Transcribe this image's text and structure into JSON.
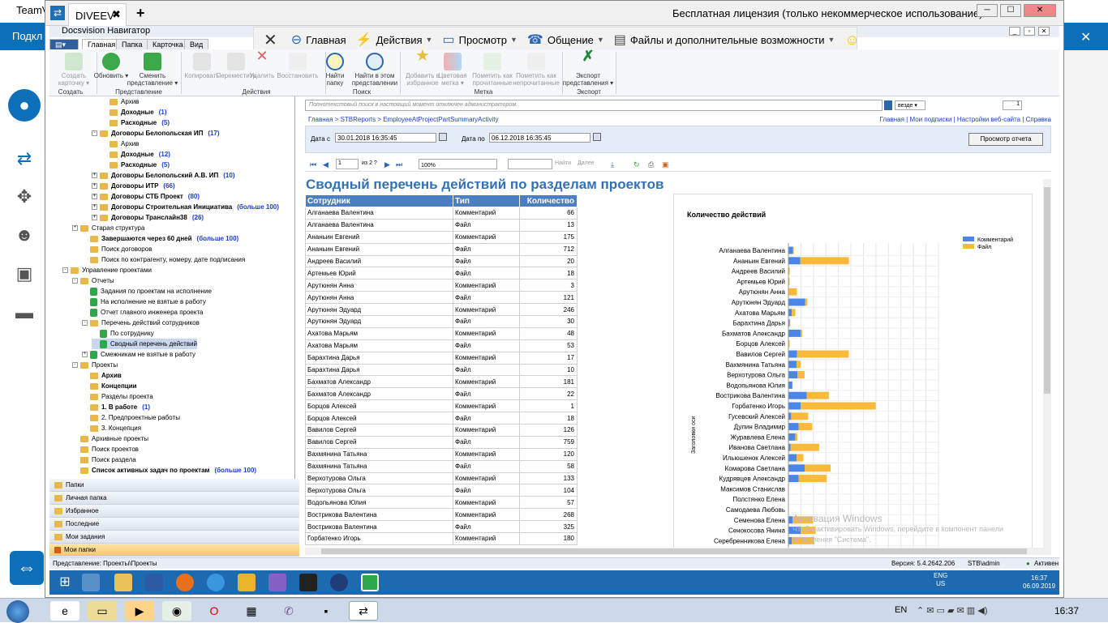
{
  "bg": {
    "tv_title": "TeamV",
    "tv_band_label": "Подкл"
  },
  "window": {
    "tab_label": "DIVEEV",
    "tab_close": "✖",
    "tab_new": "+",
    "license": "Бесплатная лицензия (только некоммерческое использование)",
    "btn_min": "─",
    "btn_max": "☐",
    "btn_close": "✕"
  },
  "app": {
    "title": "Docsvision Навигатор",
    "inner_min": "_",
    "inner_max": "▫",
    "inner_close": "✕"
  },
  "tvtoolbar": {
    "close": "✕",
    "items": [
      "Главная",
      "Действия",
      "Просмотр",
      "Общение",
      "Файлы и дополнительные возможности"
    ]
  },
  "ribbon": {
    "tabs": [
      "Главная",
      "Папка",
      "Карточка",
      "Вид"
    ],
    "buttons": {
      "create": "Создать карточку ▾",
      "refresh": "Обновить ▾",
      "change_view": "Сменить представление ▾",
      "copy": "Копировать",
      "move": "Переместить",
      "delete": "Удалить",
      "restore": "Восстановить",
      "find_folder": "Найти папку",
      "find_in_view": "Найти в этом представлении",
      "add_fav": "Добавить в избранное",
      "color_mark": "Цветовая метка ▾",
      "mark_read": "Пометить как прочитанные",
      "mark_unread": "Пометить как непрочитанные",
      "export_view": "Экспорт представления ▾"
    },
    "groups": {
      "create": "Создать",
      "view": "Представление",
      "actions": "Действия",
      "search": "Поиск",
      "mark": "Метка",
      "export": "Экспорт"
    }
  },
  "tree": [
    {
      "label": "Архив",
      "indent": 5,
      "type": "folder"
    },
    {
      "label": "Доходные",
      "count": "(1)",
      "indent": 5,
      "type": "folder",
      "bold": true
    },
    {
      "label": "Расходные",
      "count": "(5)",
      "indent": 5,
      "type": "folder",
      "bold": true
    },
    {
      "label": "Договоры Белопольская ИП",
      "count": "(17)",
      "indent": 4,
      "type": "folder",
      "bold": true,
      "toggle": "-"
    },
    {
      "label": "Архив",
      "indent": 5,
      "type": "folder"
    },
    {
      "label": "Доходные",
      "count": "(12)",
      "indent": 5,
      "type": "folder",
      "bold": true
    },
    {
      "label": "Расходные",
      "count": "(5)",
      "indent": 5,
      "type": "folder",
      "bold": true
    },
    {
      "label": "Договоры Белопольский А.В. ИП",
      "count": "(10)",
      "indent": 4,
      "type": "folder",
      "bold": true,
      "toggle": "+"
    },
    {
      "label": "Договоры ИТР",
      "count": "(66)",
      "indent": 4,
      "type": "folder",
      "bold": true,
      "toggle": "+"
    },
    {
      "label": "Договоры СТБ Проект",
      "count": "(80)",
      "indent": 4,
      "type": "folder",
      "bold": true,
      "toggle": "+"
    },
    {
      "label": "Договоры Строительная Инициатива",
      "count": "(больше 100)",
      "indent": 4,
      "type": "folder",
      "bold": true,
      "toggle": "+"
    },
    {
      "label": "Договоры Транслайн38",
      "count": "(26)",
      "indent": 4,
      "type": "folder",
      "bold": true,
      "toggle": "+"
    },
    {
      "label": "Старая структура",
      "indent": 2,
      "type": "folder",
      "toggle": "+"
    },
    {
      "label": "Завершаются через 60 дней",
      "count": "(больше 100)",
      "indent": 3,
      "type": "folder",
      "bold": true
    },
    {
      "label": "Поиск договоров",
      "indent": 3,
      "type": "folder"
    },
    {
      "label": "Поиск по контрагенту, номеру, дате подписания",
      "indent": 3,
      "type": "folder"
    },
    {
      "label": "Управление проектами",
      "indent": 1,
      "type": "folder",
      "toggle": "-"
    },
    {
      "label": "Отчеты",
      "indent": 2,
      "type": "folder",
      "toggle": "-"
    },
    {
      "label": "Задания по проектам на исполнение",
      "indent": 3,
      "type": "report"
    },
    {
      "label": "На исполнение не взятые в работу",
      "indent": 3,
      "type": "report"
    },
    {
      "label": "Отчет главного инженера проекта",
      "indent": 3,
      "type": "report"
    },
    {
      "label": "Перечень действий сотрудников",
      "indent": 3,
      "type": "folder",
      "toggle": "-"
    },
    {
      "label": "По сотруднику",
      "indent": 4,
      "type": "report"
    },
    {
      "label": "Сводный перечень действий",
      "indent": 4,
      "type": "report",
      "selected": true
    },
    {
      "label": "Смежникам не взятые в работу",
      "indent": 3,
      "type": "report",
      "toggle": "+"
    },
    {
      "label": "Проекты",
      "indent": 2,
      "type": "folder",
      "toggle": "-"
    },
    {
      "label": "Архив",
      "indent": 3,
      "type": "folder",
      "bold": true
    },
    {
      "label": "Концепции",
      "indent": 3,
      "type": "folder",
      "bold": true
    },
    {
      "label": "Разделы проекта",
      "indent": 3,
      "type": "folder"
    },
    {
      "label": "1. В работе",
      "count": "(1)",
      "indent": 3,
      "type": "folder",
      "bold": true
    },
    {
      "label": "2. Предпроектные работы",
      "indent": 3,
      "type": "folder"
    },
    {
      "label": "3. Концепция",
      "indent": 3,
      "type": "folder"
    },
    {
      "label": "Архивные проекты",
      "indent": 2,
      "type": "folder"
    },
    {
      "label": "Поиск проектов",
      "indent": 2,
      "type": "folder"
    },
    {
      "label": "Поиск раздела",
      "indent": 2,
      "type": "folder"
    },
    {
      "label": "Список активных задач по проектам",
      "count": "(больше 100)",
      "indent": 2,
      "type": "folder",
      "bold": true
    }
  ],
  "nav": [
    "Папки",
    "Личная папка",
    "Избранное",
    "Последние",
    "Мои задания",
    "Мои папки"
  ],
  "content": {
    "search_placeholder": "Полнотекстовый поиск в настоящий момент отключен администратором.",
    "search_scope": "везде",
    "page_box": "1",
    "breadcrumb": "Главная > STBReports > EmployeeAtProjectPartSummaryActivity",
    "top_links": "Главная | Мои подписки | Настройки веб-сайта | Справка",
    "date_from_label": "Дата с",
    "date_from": "30.01.2018 16:35:45",
    "date_to_label": "Дата по",
    "date_to": "06.12.2018 16:35:45",
    "view_report": "Просмотр отчета",
    "toolbar": {
      "page": "1",
      "of": "из 2 ?",
      "zoom": "100%",
      "find": "Найти",
      "next": "Далее"
    },
    "report_title": "Сводный перечень действий по разделам проектов",
    "columns": [
      "Сотрудник",
      "Тип",
      "Количество"
    ],
    "rows": [
      [
        "Алганаева Валентина",
        "Комментарий",
        "66"
      ],
      [
        "Алганаева Валентина",
        "Файл",
        "13"
      ],
      [
        "Ананьин Евгений",
        "Комментарий",
        "175"
      ],
      [
        "Ананьин Евгений",
        "Файл",
        "712"
      ],
      [
        "Андреев Василий",
        "Файл",
        "20"
      ],
      [
        "Артемьев Юрий",
        "Файл",
        "18"
      ],
      [
        "Арутюнян Анна",
        "Комментарий",
        "3"
      ],
      [
        "Арутюнян Анна",
        "Файл",
        "121"
      ],
      [
        "Арутюнян Эдуард",
        "Комментарий",
        "246"
      ],
      [
        "Арутюнян Эдуард",
        "Файл",
        "30"
      ],
      [
        "Ахатова Марьям",
        "Комментарий",
        "48"
      ],
      [
        "Ахатова Марьям",
        "Файл",
        "53"
      ],
      [
        "Барахтина Дарья",
        "Комментарий",
        "17"
      ],
      [
        "Барахтина Дарья",
        "Файл",
        "10"
      ],
      [
        "Бахматов Александр",
        "Комментарий",
        "181"
      ],
      [
        "Бахматов Александр",
        "Файл",
        "22"
      ],
      [
        "Борцов Алексей",
        "Комментарий",
        "1"
      ],
      [
        "Борцов Алексей",
        "Файл",
        "18"
      ],
      [
        "Вавилов Сергей",
        "Комментарий",
        "126"
      ],
      [
        "Вавилов Сергей",
        "Файл",
        "759"
      ],
      [
        "Вахмянина Татьяна",
        "Комментарий",
        "120"
      ],
      [
        "Вахмянина Татьяна",
        "Файл",
        "58"
      ],
      [
        "Верхотурова Ольга",
        "Комментарий",
        "133"
      ],
      [
        "Верхотурова Ольга",
        "Файл",
        "104"
      ],
      [
        "Водопьянова Юлия",
        "Комментарий",
        "57"
      ],
      [
        "Вострикова Валентина",
        "Комментарий",
        "268"
      ],
      [
        "Вострикова Валентина",
        "Файл",
        "325"
      ],
      [
        "Горбатенко Игорь",
        "Комментарий",
        "180"
      ]
    ],
    "watermark1": "Активация Windows",
    "watermark2": "Чтобы активировать Windows, перейдите в компонент панели",
    "watermark3": "управления \"Система\"."
  },
  "chart_data": {
    "type": "bar",
    "orientation": "horizontal",
    "stacked": true,
    "title": "Количество действий",
    "ylabel": "Заголовки оси",
    "legend_position": "top-right",
    "categories": [
      "Алганаева Валентина",
      "Ананьин Евгений",
      "Андреев Василий",
      "Артемьев Юрий",
      "Арутюнян Анна",
      "Арутюнян Эдуард",
      "Ахатова Марьям",
      "Барахтина Дарья",
      "Бахматов Александр",
      "Борцов Алексей",
      "Вавилов Сергей",
      "Вахмянина Татьяна",
      "Верхотурова Ольга",
      "Водопьянова Юлия",
      "Вострикова Валентина",
      "Горбатенко Игорь",
      "Гусевский Алексей",
      "Дулин Владимир",
      "Журавлева Елена",
      "Иванова Светлана",
      "Ильюшенок Алексей",
      "Комарова Светлана",
      "Кудрявцев Александр",
      "Максимов Станислав",
      "Полстянко Елена",
      "Самодаева Любовь",
      "Семенова Елена",
      "Сенокосова Янина",
      "Серебренникова Елена"
    ],
    "series": [
      {
        "name": "Комментарий",
        "color": "#4a86e8",
        "values": [
          66,
          175,
          0,
          0,
          3,
          246,
          48,
          17,
          181,
          1,
          126,
          120,
          133,
          57,
          268,
          180,
          40,
          150,
          100,
          30,
          120,
          240,
          150,
          0,
          0,
          0,
          60,
          180,
          50
        ]
      },
      {
        "name": "Файл",
        "color": "#f9b93a",
        "values": [
          13,
          712,
          20,
          18,
          121,
          30,
          53,
          10,
          22,
          18,
          759,
          58,
          104,
          0,
          325,
          1100,
          250,
          200,
          30,
          420,
          100,
          380,
          410,
          5,
          5,
          5,
          300,
          220,
          330
        ]
      }
    ],
    "xlim": [
      0,
      2200
    ],
    "grid": true
  },
  "status": {
    "view": "Представление: Проекты\\Проекты",
    "version": "Версия: 5.4.2642.206",
    "user": "STB\\admin",
    "state": "Активен"
  },
  "remote_clock": {
    "lang": "ENG",
    "region": "US",
    "time": "16:37",
    "date": "06.09.2019"
  },
  "local": {
    "lang": "EN",
    "time": "16:37"
  }
}
